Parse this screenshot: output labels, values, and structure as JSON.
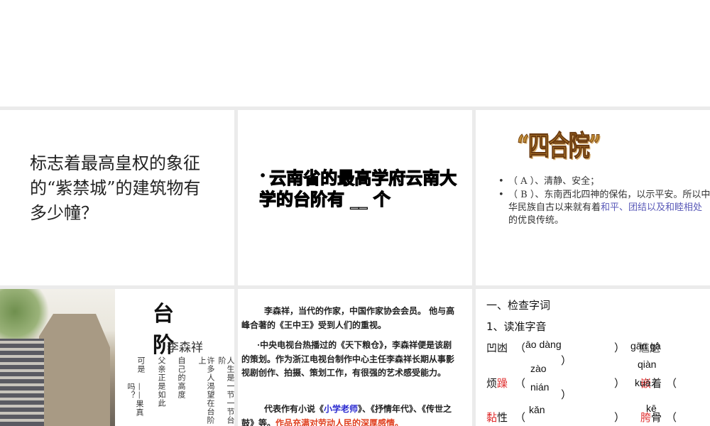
{
  "slides": [
    {
      "text": "标志着最高皇权的象征的“紫禁城”的建筑物有多少幢？"
    },
    {
      "bullet": "•",
      "text": "云南省的最高学府云南大学的台阶有 __ 个"
    },
    {
      "wordart": "“四合院”",
      "items": [
        {
          "text": "（ A ）、清静、安全；"
        },
        {
          "text_a": "（ B ）、东南西北四神的保佑，以示平安。所以中华民族自古以来就有着",
          "highlight": "和平、团结以及和睦相处",
          "text_b": "的优良传统。"
        }
      ],
      "highlight_color": "#5a5ab8"
    },
    {
      "title": "台 阶",
      "author": "李森祥",
      "columns": [
        "人生是一节一节台阶",
        "许多人渴望在台阶上",
        "自己的高度",
        "父亲正是如此",
        "可是",
        "——果真吗？"
      ]
    },
    {
      "p1": "李森祥，当代的作家，中国作家协会会员。 他与高峰合著的《王中王》受到人们的重视。",
      "p2": "·中央电视台热播过的《天下粮仓》，李森祥便是该剧的策划。作为浙江电视台制作中心主任李森祥长期从事影视剧创作、拍摄、策划工作，有很强的艺术感受能力。",
      "p3_a": "代表作有小说《",
      "p3_blue": "小学老师",
      "p3_b": "》、《抒情年代》、《传世之鼓》等。",
      "p3_red": "作品充满对劳动人民的深厚感情。"
    },
    {
      "heading1": "一、检查字词",
      "heading2": "1、读准字音",
      "rows": [
        {
          "w1": "凹凼",
          "p1": "āo dàng",
          "w2": "尴尬",
          "p2": "gān gà"
        },
        {
          "w1a": "烦",
          "w1b": "躁",
          "p1": "zào",
          "w2a": "嵌",
          "w2b": "着",
          "p2": "qiàn"
        },
        {
          "w1a": "黏",
          "w1b": "性",
          "p1": "nián",
          "w2a": "胯",
          "w2b": "骨",
          "p2": "kuà"
        }
      ],
      "extra": {
        "p_kan": "kǎn",
        "p_ke": "kē",
        "paren_open": "（",
        "paren_close": "）"
      }
    }
  ]
}
